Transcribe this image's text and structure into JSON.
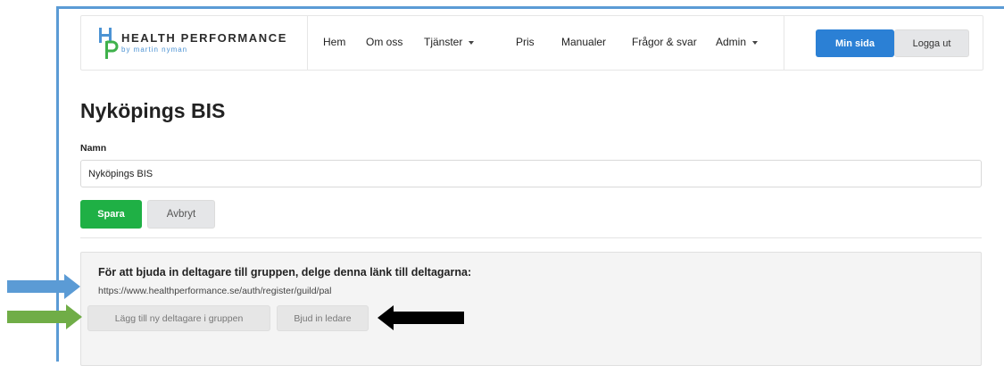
{
  "brand": {
    "name": "HEALTH PERFORMANCE",
    "subtitle": "by martin nyman",
    "colors": {
      "blue": "#4c93d4",
      "green": "#3fb14b"
    }
  },
  "nav": {
    "items": [
      {
        "label": "Hem"
      },
      {
        "label": "Om oss"
      },
      {
        "label": "Tjänster"
      },
      {
        "label": "Pris"
      },
      {
        "label": "Manualer"
      },
      {
        "label": "Frågor & svar"
      },
      {
        "label": "Admin"
      }
    ],
    "my_page": "Min sida",
    "logout": "Logga ut"
  },
  "page": {
    "title": "Nyköpings BIS",
    "name_label": "Namn",
    "name_value": "Nyköpings BIS",
    "save": "Spara",
    "cancel": "Avbryt"
  },
  "invite": {
    "heading": "För att bjuda in deltagare till gruppen, delge denna länk till deltagarna:",
    "link": "https://www.healthperformance.se/auth/register/guild/pal",
    "add_participant": "Lägg till ny deltagare i gruppen",
    "invite_leader": "Bjud in ledare"
  },
  "colors": {
    "primary": "#2b80d5",
    "success": "#1fb045",
    "frame": "#5b9bd5",
    "arrow_blue": "#5b9bd5",
    "arrow_green": "#70ad47",
    "arrow_black": "#000000"
  }
}
